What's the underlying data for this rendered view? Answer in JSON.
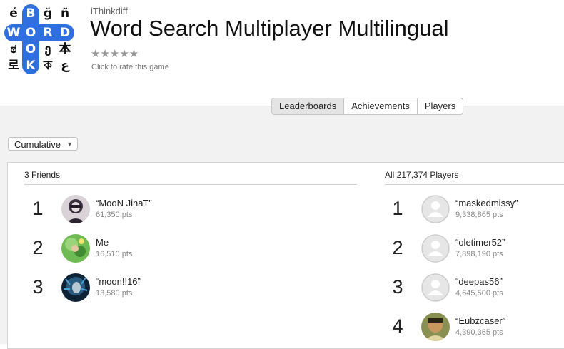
{
  "app": {
    "developer": "iThinkdiff",
    "title": "Word Search Multiplayer Multilingual",
    "stars": "★★★★★",
    "rate_prompt": "Click to rate this game",
    "icon_letters": [
      [
        "é",
        "B",
        "ğ",
        "ñ"
      ],
      [
        "W",
        "O",
        "R",
        "D"
      ],
      [
        "ಠ",
        "O",
        "ე",
        "本"
      ],
      [
        "로",
        "K",
        "ক",
        "ع"
      ]
    ]
  },
  "tabs": [
    {
      "label": "Leaderboards",
      "active": true
    },
    {
      "label": "Achievements",
      "active": false
    },
    {
      "label": "Players",
      "active": false
    }
  ],
  "filter": {
    "selected": "Cumulative"
  },
  "friends": {
    "header": "3 Friends",
    "entries": [
      {
        "rank": "1",
        "name": "“MooN JinaT”",
        "points": "61,350 pts",
        "avatar": "moon-jinat-avatar",
        "color": "#4a3f4f"
      },
      {
        "rank": "2",
        "name": "Me",
        "points": "16,510 pts",
        "avatar": "me-avatar",
        "color": "#5aa645"
      },
      {
        "rank": "3",
        "name": "“moon!!16”",
        "points": "13,580 pts",
        "avatar": "moon16-avatar",
        "color": "#1c3c56"
      }
    ]
  },
  "all_players": {
    "header": "All 217,374 Players",
    "entries": [
      {
        "rank": "1",
        "name": "“maskedmissy”",
        "points": "9,338,865 pts",
        "avatar": "placeholder-avatar"
      },
      {
        "rank": "2",
        "name": "“oletimer52”",
        "points": "7,898,190 pts",
        "avatar": "placeholder-avatar"
      },
      {
        "rank": "3",
        "name": "“deepas56”",
        "points": "4,645,500 pts",
        "avatar": "placeholder-avatar"
      },
      {
        "rank": "4",
        "name": "“Eubzcaser”",
        "points": "4,390,365 pts",
        "avatar": "photo-avatar"
      }
    ]
  },
  "colors": {
    "accent": "#2f6fe0",
    "background": "#f2f2f2"
  }
}
